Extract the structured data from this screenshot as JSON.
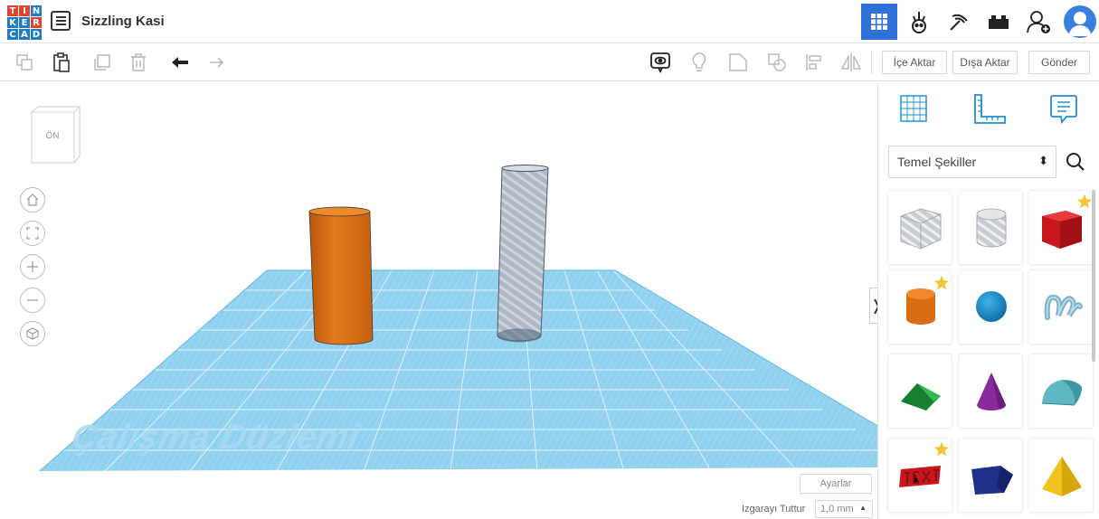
{
  "header": {
    "logo_letters": [
      "T",
      "I",
      "N",
      "K",
      "E",
      "R",
      "C",
      "A",
      "D"
    ],
    "logo_colors": [
      "#e2452c",
      "#e2452c",
      "#1e7cc7",
      "#1e7cc7",
      "#1e7cc7",
      "#e2452c",
      "#1e7cc7",
      "#1e7cc7",
      "#1e7cc7"
    ],
    "design_title": "Sizzling Kasi",
    "icons": [
      "list-icon",
      "grid-view-icon",
      "robot-icon",
      "pickaxe-icon",
      "bricks-icon",
      "add-user-icon",
      "user-avatar-icon"
    ]
  },
  "toolbar": {
    "left_icons": [
      "copy-icon",
      "paste-icon",
      "duplicate-icon",
      "delete-icon",
      "undo-icon",
      "redo-icon"
    ],
    "right_icons": [
      "notes-icon",
      "light-bulb-icon",
      "group-icon",
      "ungroup-icon",
      "align-icon",
      "mirror-icon"
    ],
    "import_label": "İçe Aktar",
    "export_label": "Dışa Aktar",
    "send_label": "Gönder"
  },
  "viewport": {
    "view_cube_label": "ÖN",
    "plane_label": "Çalışma Düzlemi",
    "settings_label": "Ayarlar",
    "snap_label": "Izgarayı Tuttur",
    "snap_value": "1,0 mm"
  },
  "panel": {
    "tabs": [
      "workplane-grid-icon",
      "ruler-icon",
      "notes-icon"
    ],
    "category": "Temel Şekiller",
    "shapes": [
      {
        "name": "box-hole",
        "favorite": false
      },
      {
        "name": "cylinder-hole",
        "favorite": false
      },
      {
        "name": "box",
        "favorite": true
      },
      {
        "name": "cylinder",
        "favorite": true
      },
      {
        "name": "sphere",
        "favorite": false
      },
      {
        "name": "scribble",
        "favorite": false
      },
      {
        "name": "roof",
        "favorite": false
      },
      {
        "name": "cone",
        "favorite": false
      },
      {
        "name": "round-roof",
        "favorite": false
      },
      {
        "name": "text",
        "favorite": true
      },
      {
        "name": "polygon",
        "favorite": false
      },
      {
        "name": "pyramid",
        "favorite": false
      }
    ]
  },
  "colors": {
    "accent": "#2f6fd8",
    "workplane": "#8fd0ef",
    "orange": "#d96d14",
    "star": "#f6c431"
  }
}
